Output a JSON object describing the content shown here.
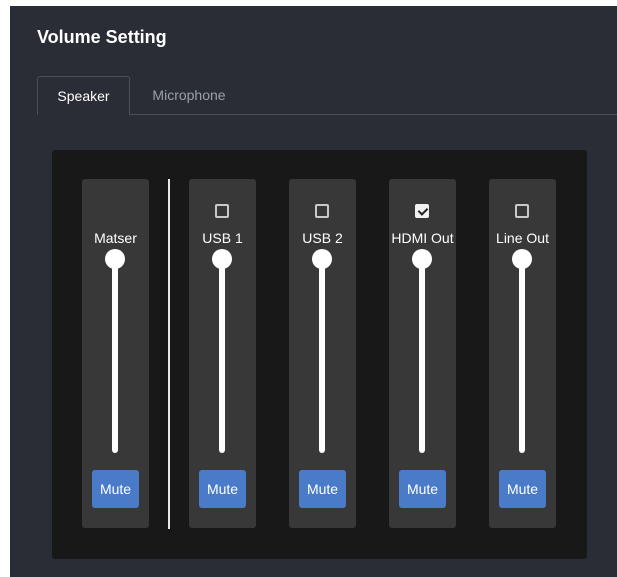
{
  "panel": {
    "title": "Volume Setting"
  },
  "tabs": [
    {
      "label": "Speaker",
      "active": true
    },
    {
      "label": "Microphone",
      "active": false
    }
  ],
  "channels": [
    {
      "label": "Matser",
      "has_checkbox": false,
      "checked": false,
      "level": 1.0,
      "mute_label": "Mute"
    },
    {
      "label": "USB 1",
      "has_checkbox": true,
      "checked": false,
      "level": 1.0,
      "mute_label": "Mute"
    },
    {
      "label": "USB 2",
      "has_checkbox": true,
      "checked": false,
      "level": 1.0,
      "mute_label": "Mute"
    },
    {
      "label": "HDMI Out",
      "has_checkbox": true,
      "checked": true,
      "level": 1.0,
      "mute_label": "Mute"
    },
    {
      "label": "Line Out",
      "has_checkbox": true,
      "checked": false,
      "level": 1.0,
      "mute_label": "Mute"
    }
  ],
  "colors": {
    "panel_bg": "#2a2d36",
    "mixer_bg": "#181818",
    "channel_bg": "#383838",
    "mute_button": "#4a7bc8",
    "text": "#ffffff",
    "inactive_tab_text": "#9aa0aa"
  }
}
